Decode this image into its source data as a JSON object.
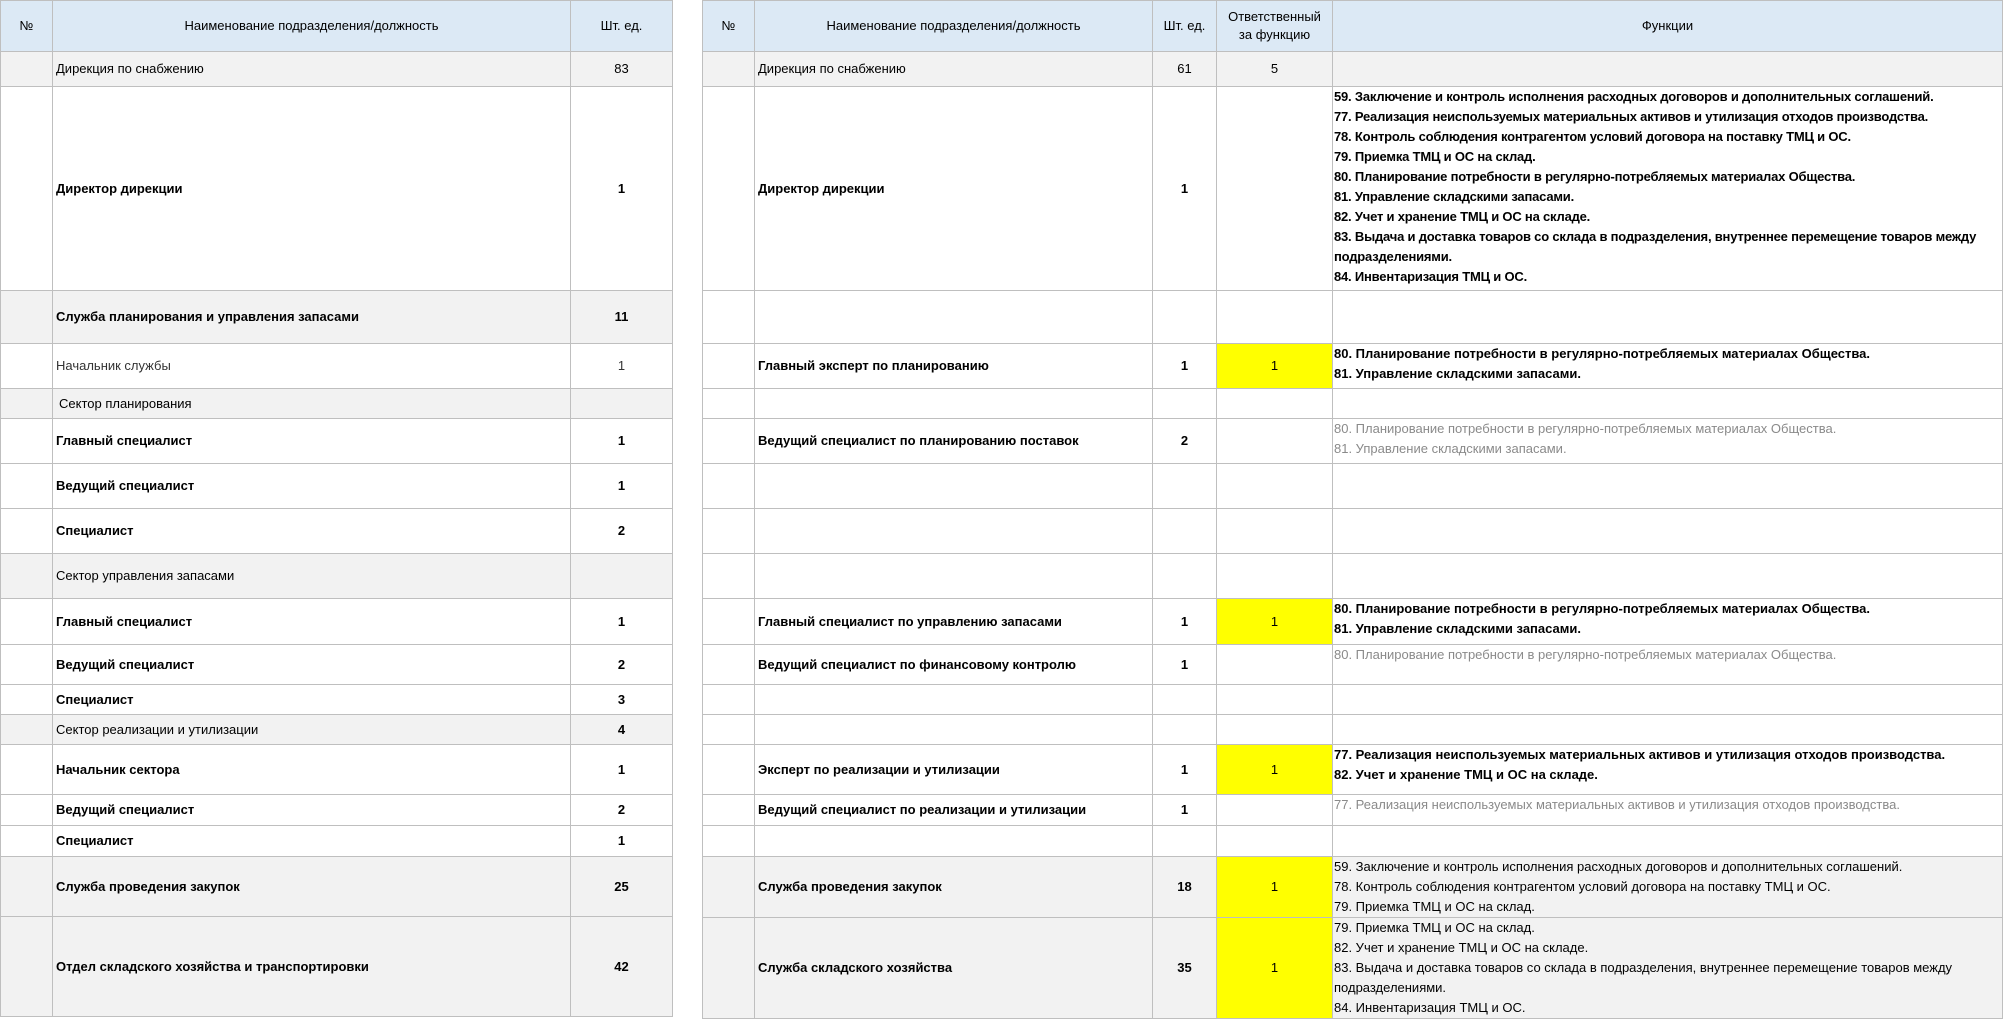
{
  "headers": {
    "num": "№",
    "name": "Наименование подразделения/должность",
    "count": "Шт. ед.",
    "responsible": "Ответственный за функцию",
    "functions": "Функции"
  },
  "left_rows": [
    {
      "name": "Дирекция по снабжению",
      "count": "83"
    },
    {
      "name": "Директор дирекции",
      "count": "1"
    },
    {
      "name": "Служба планирования и управления запасами",
      "count": "11"
    },
    {
      "name": "Начальник службы",
      "count": "1"
    },
    {
      "name": "Сектор планирования",
      "count": ""
    },
    {
      "name": "Главный специалист",
      "count": "1"
    },
    {
      "name": "Ведущий специалист",
      "count": "1"
    },
    {
      "name": "Специалист",
      "count": "2"
    },
    {
      "name": "Сектор управления запасами",
      "count": ""
    },
    {
      "name": "Главный специалист",
      "count": "1"
    },
    {
      "name": "Ведущий специалист",
      "count": "2"
    },
    {
      "name": "Специалист",
      "count": "3"
    },
    {
      "name": "Сектор реализации и утилизации",
      "count": "4"
    },
    {
      "name": "Начальник сектора",
      "count": "1"
    },
    {
      "name": "Ведущий специалист",
      "count": "2"
    },
    {
      "name": "Специалист",
      "count": "1"
    },
    {
      "name": "Служба проведения закупок",
      "count": "25"
    },
    {
      "name": "Отдел складского хозяйства и транспортировки",
      "count": "42"
    }
  ],
  "right_rows": [
    {
      "name": "Дирекция по снабжению",
      "count": "61",
      "resp": "5",
      "functions": []
    },
    {
      "name": "Директор дирекции",
      "count": "1",
      "resp": "",
      "functions": [
        "59. Заключение и контроль исполнения расходных договоров и дополнительных соглашений.",
        "77. Реализация неиспользуемых материальных активов и утилизация отходов производства.",
        "78. Контроль соблюдения контрагентом условий договора на поставку ТМЦ и ОС.",
        "79. Приемка ТМЦ и ОС на склад.",
        "80. Планирование потребности в регулярно-потребляемых материалах Общества.",
        "81. Управление складскими запасами.",
        "82. Учет и хранение ТМЦ и ОС на складе.",
        "83. Выдача и доставка товаров со склада в подразделения, внутреннее перемещение товаров между подразделениями.",
        "84. Инвентаризация ТМЦ и ОС."
      ]
    },
    {
      "name": "",
      "count": "",
      "resp": "",
      "functions": []
    },
    {
      "name": "Главный эксперт по планированию",
      "count": "1",
      "resp": "1",
      "functions": [
        "80. Планирование потребности в регулярно-потребляемых материалах Общества.",
        "81. Управление складскими запасами."
      ]
    },
    {
      "name": "",
      "count": "",
      "resp": "",
      "functions": []
    },
    {
      "name": "Ведущий специалист по планированию поставок",
      "count": "2",
      "resp": "",
      "functions": [
        "80. Планирование потребности в регулярно-потребляемых материалах Общества.",
        "81. Управление складскими запасами."
      ]
    },
    {
      "name": "",
      "count": "",
      "resp": "",
      "functions": []
    },
    {
      "name": "",
      "count": "",
      "resp": "",
      "functions": []
    },
    {
      "name": "",
      "count": "",
      "resp": "",
      "functions": []
    },
    {
      "name": "Главный специалист по управлению запасами",
      "count": "1",
      "resp": "1",
      "functions": [
        "80. Планирование потребности в регулярно-потребляемых материалах Общества.",
        "81. Управление складскими запасами."
      ]
    },
    {
      "name": "Ведущий специалист по финансовому контролю",
      "count": "1",
      "resp": "",
      "functions": [
        "80. Планирование потребности в регулярно-потребляемых материалах Общества."
      ]
    },
    {
      "name": "",
      "count": "",
      "resp": "",
      "functions": []
    },
    {
      "name": "",
      "count": "",
      "resp": "",
      "functions": []
    },
    {
      "name": "Эксперт по реализации и утилизации",
      "count": "1",
      "resp": "1",
      "functions": [
        "77. Реализация неиспользуемых материальных активов и утилизация отходов производства.",
        "82. Учет и хранение ТМЦ и ОС на складе."
      ]
    },
    {
      "name": "Ведущий специалист по реализации и утилизации",
      "count": "1",
      "resp": "",
      "functions": [
        "77. Реализация неиспользуемых материальных активов и утилизация отходов производства."
      ]
    },
    {
      "name": "",
      "count": "",
      "resp": "",
      "functions": []
    },
    {
      "name": "Служба проведения закупок",
      "count": "18",
      "resp": "1",
      "functions": [
        "59. Заключение и контроль исполнения расходных договоров и дополнительных соглашений.",
        "78. Контроль соблюдения контрагентом условий договора на поставку ТМЦ и ОС.",
        "79. Приемка ТМЦ и ОС на склад."
      ]
    },
    {
      "name": "Служба складского хозяйства",
      "count": "35",
      "resp": "1",
      "functions": [
        "79. Приемка ТМЦ и ОС на склад.",
        "82. Учет и хранение ТМЦ и ОС на складе.",
        "83. Выдача и доставка товаров со склада в подразделения, внутреннее перемещение товаров между подразделениями.",
        "84. Инвентаризация ТМЦ и ОС."
      ]
    }
  ]
}
